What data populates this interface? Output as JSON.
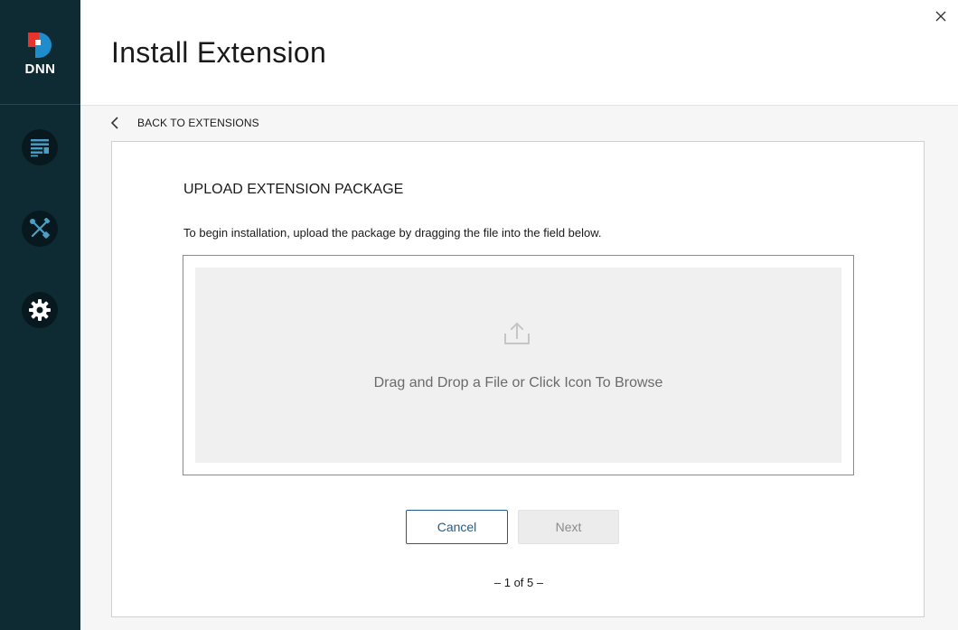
{
  "sidebar": {
    "logo_text": "DNN",
    "items": [
      {
        "name": "content",
        "icon": "list-icon"
      },
      {
        "name": "tools",
        "icon": "wrench-screwdriver-icon"
      },
      {
        "name": "settings",
        "icon": "gear-icon"
      }
    ]
  },
  "header": {
    "title": "Install Extension",
    "close_icon": "close-icon"
  },
  "nav": {
    "back_label": "BACK TO EXTENSIONS",
    "back_icon": "chevron-left-icon"
  },
  "upload": {
    "section_title": "UPLOAD EXTENSION PACKAGE",
    "instructions": "To begin installation, upload the package by dragging the file into the field below.",
    "drop_text": "Drag and Drop a File or Click Icon To Browse",
    "upload_icon": "upload-icon"
  },
  "actions": {
    "cancel_label": "Cancel",
    "next_label": "Next",
    "next_enabled": false
  },
  "pager": {
    "text": "– 1 of 5 –"
  },
  "colors": {
    "sidebar_bg": "#0e2a33",
    "sidebar_button_bg": "#07181e",
    "sidebar_icon": "#4a9fc7",
    "accent_blue": "#1e5f8a",
    "logo_red": "#e8322b",
    "logo_blue": "#1f8ccb"
  }
}
